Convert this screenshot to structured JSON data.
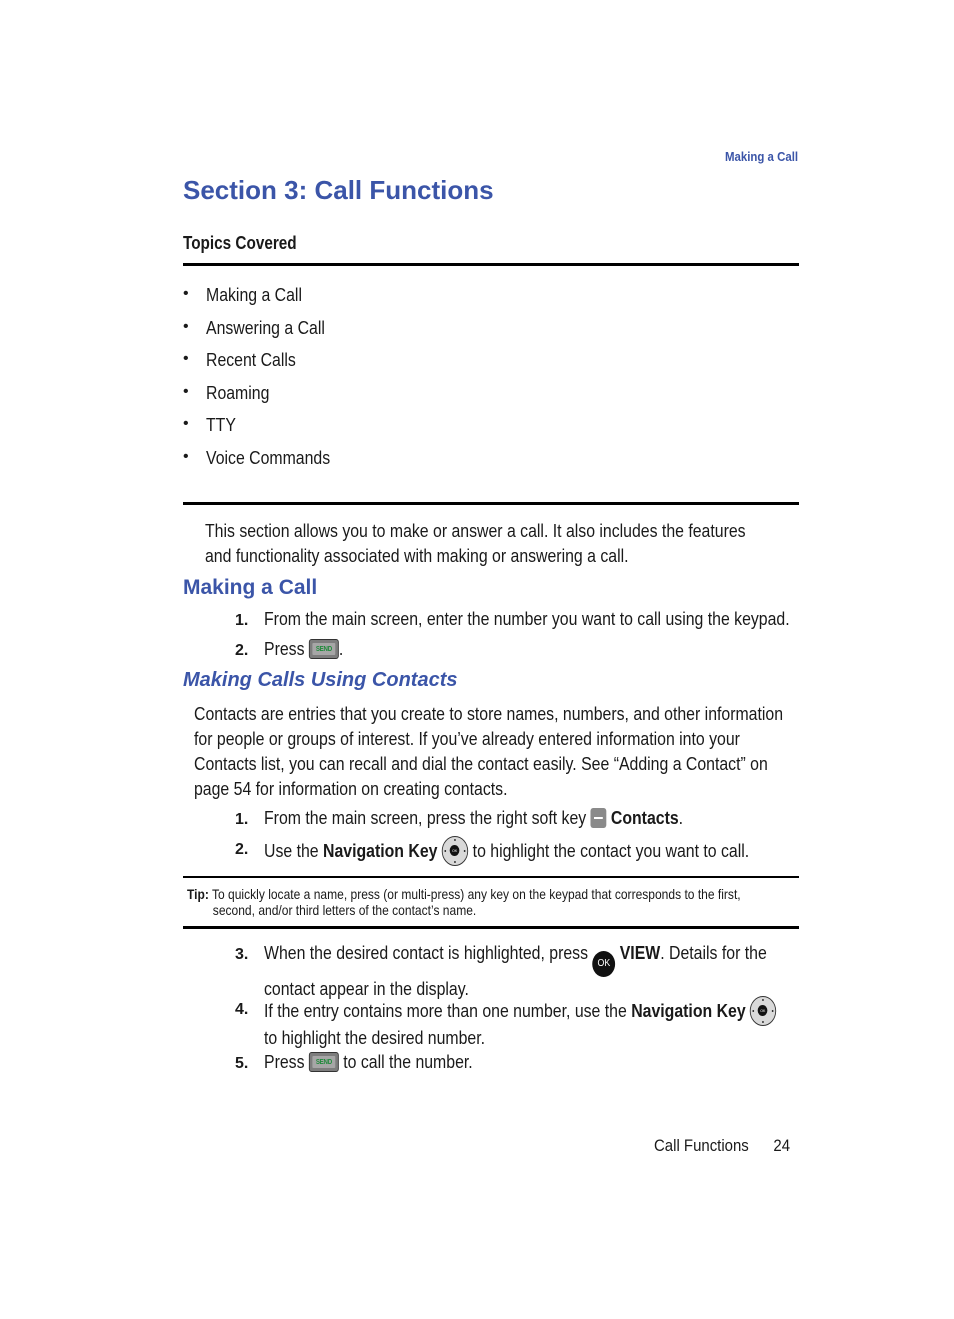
{
  "running_head": "Making a Call",
  "section_title": "Section 3: Call Functions",
  "topics_heading": "Topics Covered",
  "topics": [
    "Making a Call",
    "Answering a Call",
    "Recent Calls",
    "Roaming",
    "TTY",
    "Voice Commands"
  ],
  "bullet": "•",
  "intro": "This section allows you to make or answer a call. It also includes the features and functionality associated with making or answering a call.",
  "making_a_call": {
    "heading": "Making a Call",
    "steps": [
      {
        "num": "1.",
        "text": "From the main screen, enter the number you want to call using the keypad."
      },
      {
        "num": "2.",
        "text_before": "Press",
        "icon": "send-key-icon",
        "text_after": "."
      }
    ]
  },
  "contacts": {
    "heading": "Making Calls Using Contacts",
    "paragraph": "Contacts are entries that you create to store names, numbers, and other information for people or groups of interest. If you’ve already entered information into your Contacts list, you can recall and dial the contact easily. See “Adding a Contact” on page 54 for information on creating contacts.",
    "steps": [
      {
        "num": "1.",
        "text_before": "From the main screen, press the right soft key",
        "icon": "soft-key-icon",
        "bold": "Contacts",
        "text_after": "."
      },
      {
        "num": "2.",
        "text_before": "Use the",
        "bold": "Navigation Key",
        "icon": "navigation-key-icon",
        "text_after": "to highlight the contact you want to call."
      },
      {
        "num": "3.",
        "line1_before": "When the desired contact is highlighted, press",
        "icon": "ok-key-icon",
        "bold": "VIEW",
        "line1_after": ". Details for the",
        "line2": "contact appear in the display."
      },
      {
        "num": "4.",
        "line1_before": "If the entry contains more than one number, use the",
        "bold": "Navigation Key",
        "icon": "navigation-key-icon",
        "line2": "to highlight the desired number."
      },
      {
        "num": "5.",
        "text_before": "Press",
        "icon": "send-key-icon",
        "text_after": "to call the number."
      }
    ],
    "tip": {
      "label": "Tip:",
      "line1": "To quickly locate a name, press (or multi-press) any key on the keypad that corresponds to the first,",
      "line2": "second, and/or third letters of the contact’s name."
    }
  },
  "icons": {
    "send_label": "SEND",
    "ok_label": "OK"
  },
  "footer": {
    "section": "Call Functions",
    "page": "24"
  },
  "colors": {
    "heading_blue": "#3b55a8",
    "send_green": "#1f8a3a"
  }
}
